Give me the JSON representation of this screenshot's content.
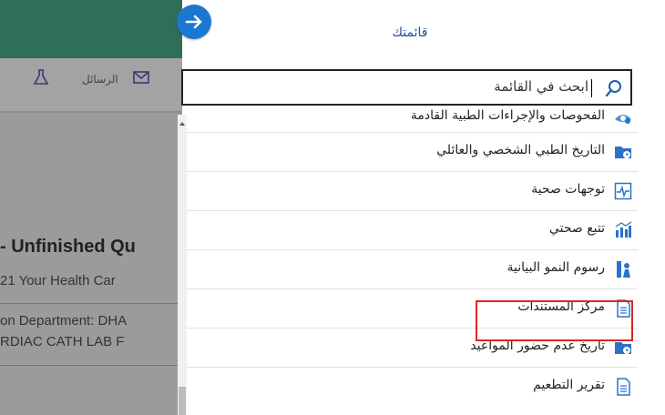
{
  "background": {
    "toolbar": [
      {
        "label": "الرسائل",
        "icon": "envelope-icon"
      },
      {
        "label": "",
        "icon": "flask-icon"
      }
    ],
    "heading": "- Unfinished Qu",
    "line1": "21   Your Health Car",
    "line2": "on Department: DHA",
    "line3": "RDIAC CATH LAB F"
  },
  "menu": {
    "title": "قائمتك",
    "search_placeholder": "ابحث في القائمة",
    "items": [
      {
        "label": "الفحوصات والإجراءات الطبية القادمة",
        "icon": "eye-icon",
        "color": "#1b78d0"
      },
      {
        "label": "التاريخ الطبي الشخصي والعائلي",
        "icon": "folder-clock-icon",
        "color": "#1b78d0"
      },
      {
        "label": "توجهات صحية",
        "icon": "heartbeat-icon",
        "color": "#1b78d0"
      },
      {
        "label": "تتبع صحتي",
        "icon": "bar-chart-icon",
        "color": "#1b78d0"
      },
      {
        "label": "رسوم النمو البيانية",
        "icon": "growth-chart-icon",
        "color": "#1b78d0"
      },
      {
        "label": "مركز المستندات",
        "icon": "document-icon",
        "color": "#1b78d0"
      },
      {
        "label": "تاريخ عدم حضور المواعيد",
        "icon": "folder-clock-icon",
        "color": "#1b78d0"
      },
      {
        "label": "تقرير التطعيم",
        "icon": "document-icon",
        "color": "#1b78d0"
      }
    ]
  },
  "colors": {
    "accent": "#1b78d0",
    "highlight": "#e02424",
    "header_bg": "#2f6f57"
  }
}
